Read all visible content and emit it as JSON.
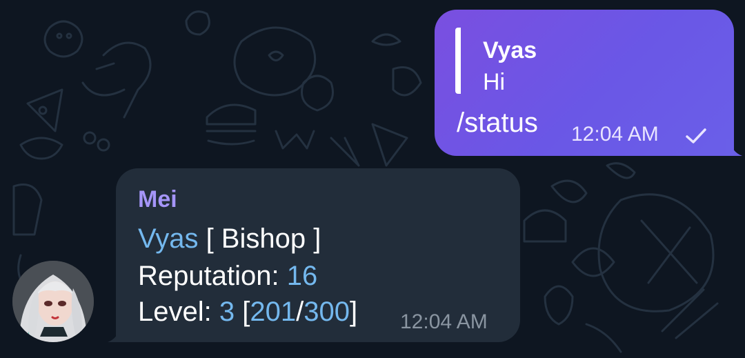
{
  "colors": {
    "background": "#0e1621",
    "outgoing_bubble": "#6a57e6",
    "incoming_bubble": "#222d3a",
    "sender_name": "#a595f8",
    "highlight": "#74b8ee"
  },
  "outgoing": {
    "reply_to_name": "Vyas",
    "reply_to_text": "Hi",
    "text": "/status",
    "time": "12:04 AM",
    "status_icon": "single-check-icon"
  },
  "incoming": {
    "sender": "Mei",
    "line1": {
      "name": "Vyas",
      "open": " [ ",
      "rank": "Bishop",
      "close": " ]"
    },
    "line2": {
      "label": "Reputation: ",
      "value": "16"
    },
    "line3": {
      "label": "Level: ",
      "level": "3",
      "open": " [",
      "current": "201",
      "sep": "/",
      "max": "300",
      "close": "]"
    },
    "time": "12:04 AM",
    "avatar": "anime-girl-avatar"
  }
}
